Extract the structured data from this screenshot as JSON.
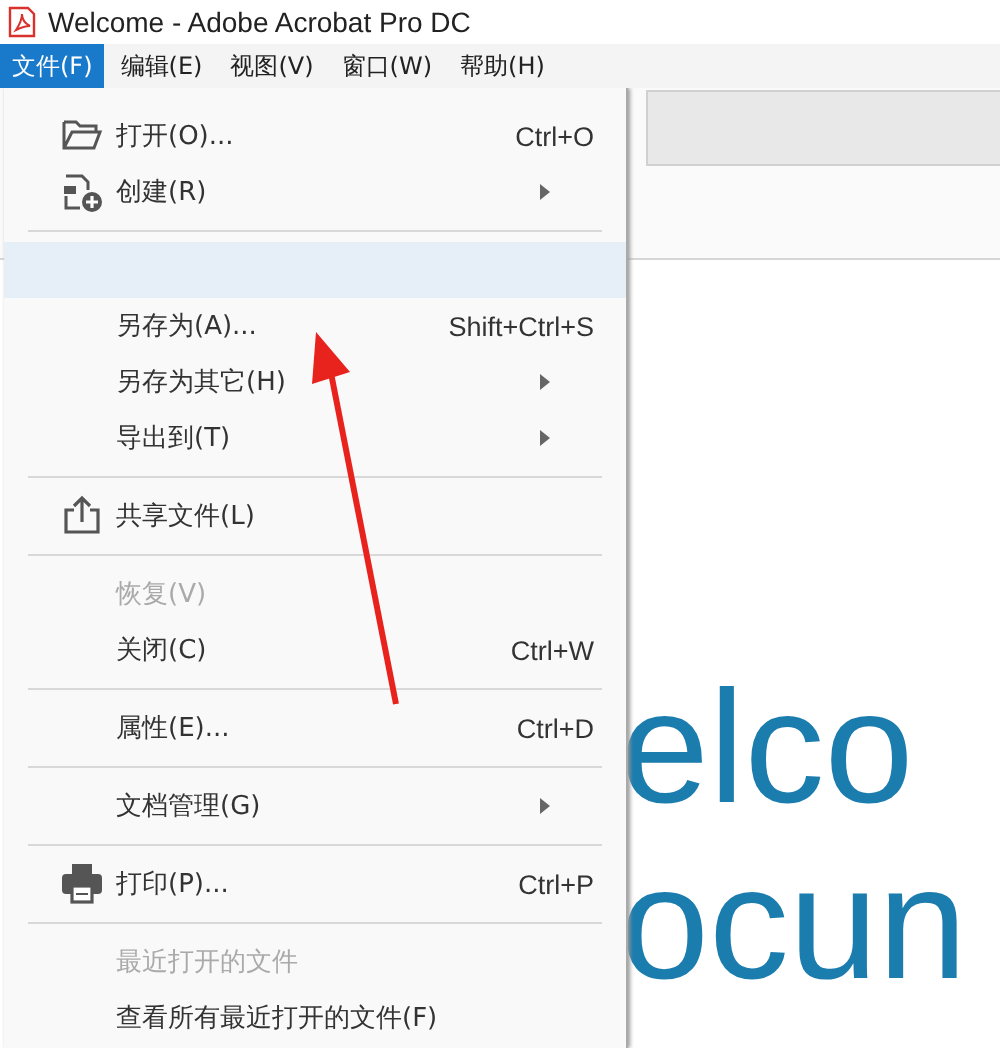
{
  "window": {
    "title": "Welcome - Adobe Acrobat Pro DC"
  },
  "menubar": [
    {
      "label": "文件(F)",
      "selected": true
    },
    {
      "label": "编辑(E)",
      "selected": false
    },
    {
      "label": "视图(V)",
      "selected": false
    },
    {
      "label": "窗口(W)",
      "selected": false
    },
    {
      "label": "帮助(H)",
      "selected": false
    }
  ],
  "menu": [
    {
      "kind": "item",
      "label": "打开(O)...",
      "shortcut": "Ctrl+O",
      "submenu": false,
      "disabled": false,
      "highlighted": false
    },
    {
      "kind": "item",
      "label": "创建(R)",
      "submenu": true,
      "disabled": false,
      "highlighted": false
    },
    {
      "kind": "separator"
    },
    {
      "kind": "blank",
      "highlighted": true
    },
    {
      "kind": "item",
      "label": "另存为(A)...",
      "shortcut": "Shift+Ctrl+S",
      "submenu": false,
      "disabled": false,
      "highlighted": false
    },
    {
      "kind": "item",
      "label": "另存为其它(H)",
      "submenu": true,
      "disabled": false,
      "highlighted": false
    },
    {
      "kind": "item",
      "label": "导出到(T)",
      "submenu": true,
      "disabled": false,
      "highlighted": false
    },
    {
      "kind": "separator"
    },
    {
      "kind": "item",
      "label": "共享文件(L)",
      "submenu": false,
      "disabled": false,
      "highlighted": false
    },
    {
      "kind": "separator"
    },
    {
      "kind": "item",
      "label": "恢复(V)",
      "submenu": false,
      "disabled": true,
      "highlighted": false
    },
    {
      "kind": "item",
      "label": "关闭(C)",
      "shortcut": "Ctrl+W",
      "submenu": false,
      "disabled": false,
      "highlighted": false
    },
    {
      "kind": "separator"
    },
    {
      "kind": "item",
      "label": "属性(E)...",
      "shortcut": "Ctrl+D",
      "submenu": false,
      "disabled": false,
      "highlighted": false
    },
    {
      "kind": "separator"
    },
    {
      "kind": "item",
      "label": "文档管理(G)",
      "submenu": true,
      "disabled": false,
      "highlighted": false
    },
    {
      "kind": "separator"
    },
    {
      "kind": "item",
      "label": "打印(P)...",
      "shortcut": "Ctrl+P",
      "submenu": false,
      "disabled": false,
      "highlighted": false
    },
    {
      "kind": "separator"
    },
    {
      "kind": "item",
      "label": "最近打开的文件",
      "submenu": false,
      "disabled": true,
      "highlighted": false
    },
    {
      "kind": "item",
      "label": "查看所有最近打开的文件(F)",
      "submenu": false,
      "disabled": false,
      "highlighted": false
    }
  ],
  "document": {
    "heading_lines": [
      "elco",
      "ocun"
    ]
  }
}
